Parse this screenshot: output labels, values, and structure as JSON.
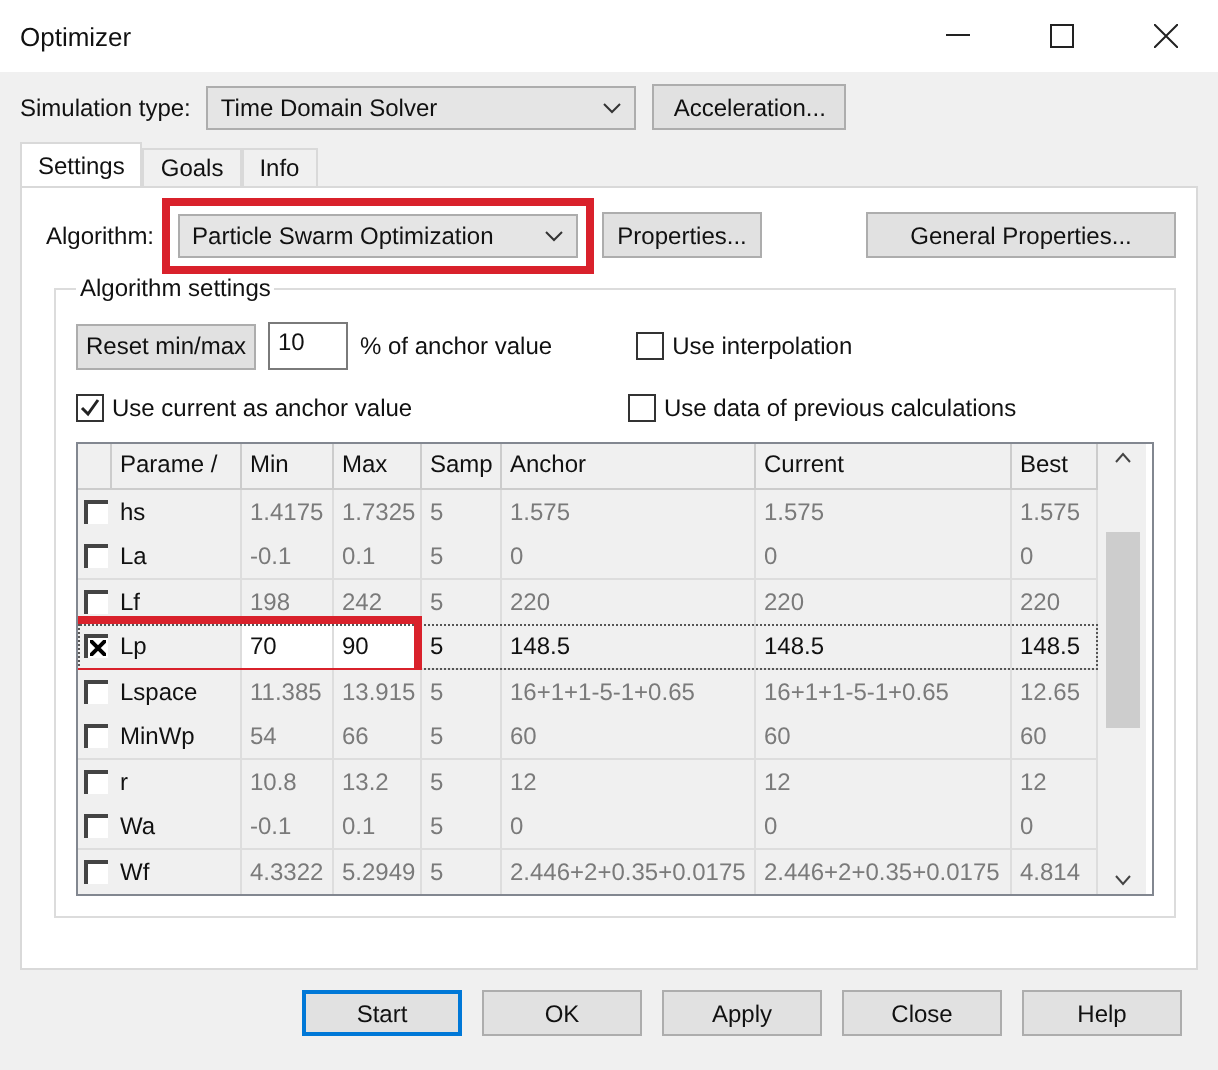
{
  "window": {
    "title": "Optimizer"
  },
  "simulation_type": {
    "label": "Simulation type:",
    "value": "Time Domain Solver",
    "button": "Acceleration..."
  },
  "tabs": [
    {
      "label": "Settings",
      "selected": true
    },
    {
      "label": "Goals",
      "selected": false
    },
    {
      "label": "Info",
      "selected": false
    }
  ],
  "algorithm": {
    "label": "Algorithm:",
    "value": "Particle Swarm Optimization",
    "highlighted": true,
    "properties_button": "Properties...",
    "general_button": "General Properties..."
  },
  "algorithm_settings": {
    "title": "Algorithm settings",
    "reset_button": "Reset min/max",
    "percent": "10",
    "percent_label": "% of anchor value",
    "options": [
      {
        "label": "Use interpolation",
        "checked": false
      },
      {
        "label": "Use current as anchor value",
        "checked": true
      },
      {
        "label": "Use data of previous calculations",
        "checked": false
      }
    ]
  },
  "table": {
    "columns": [
      "Parame /",
      "Min",
      "Max",
      "Samp",
      "Anchor",
      "Current",
      "Best"
    ],
    "rows": [
      {
        "checked": false,
        "highlighted": false,
        "cells": [
          "hs",
          "1.4175",
          "1.7325",
          "5",
          "1.575",
          "1.575",
          "1.575"
        ]
      },
      {
        "checked": false,
        "highlighted": false,
        "cells": [
          "La",
          "-0.1",
          "0.1",
          "5",
          "0",
          "0",
          "0"
        ]
      },
      {
        "checked": false,
        "highlighted": false,
        "cells": [
          "Lf",
          "198",
          "242",
          "5",
          "220",
          "220",
          "220"
        ]
      },
      {
        "checked": true,
        "highlighted": true,
        "cells": [
          "Lp",
          "70",
          "90",
          "5",
          "148.5",
          "148.5",
          "148.5"
        ]
      },
      {
        "checked": false,
        "highlighted": false,
        "cells": [
          "Lspace",
          "11.385",
          "13.915",
          "5",
          "16+1+1-5-1+0.65",
          "16+1+1-5-1+0.65",
          "12.65"
        ]
      },
      {
        "checked": false,
        "highlighted": false,
        "cells": [
          "MinWp",
          "54",
          "66",
          "5",
          "60",
          "60",
          "60"
        ]
      },
      {
        "checked": false,
        "highlighted": false,
        "cells": [
          "r",
          "10.8",
          "13.2",
          "5",
          "12",
          "12",
          "12"
        ]
      },
      {
        "checked": false,
        "highlighted": false,
        "cells": [
          "Wa",
          "-0.1",
          "0.1",
          "5",
          "0",
          "0",
          "0"
        ]
      },
      {
        "checked": false,
        "highlighted": false,
        "cells": [
          "Wf",
          "4.3322",
          "5.2949",
          "5",
          "2.446+2+0.35+0.0175",
          "2.446+2+0.35+0.0175",
          "4.814"
        ]
      }
    ]
  },
  "buttons": [
    {
      "label": "Start",
      "selected": true
    },
    {
      "label": "OK",
      "selected": false
    },
    {
      "label": "Apply",
      "selected": false
    },
    {
      "label": "Close",
      "selected": false
    },
    {
      "label": "Help",
      "selected": false
    }
  ]
}
